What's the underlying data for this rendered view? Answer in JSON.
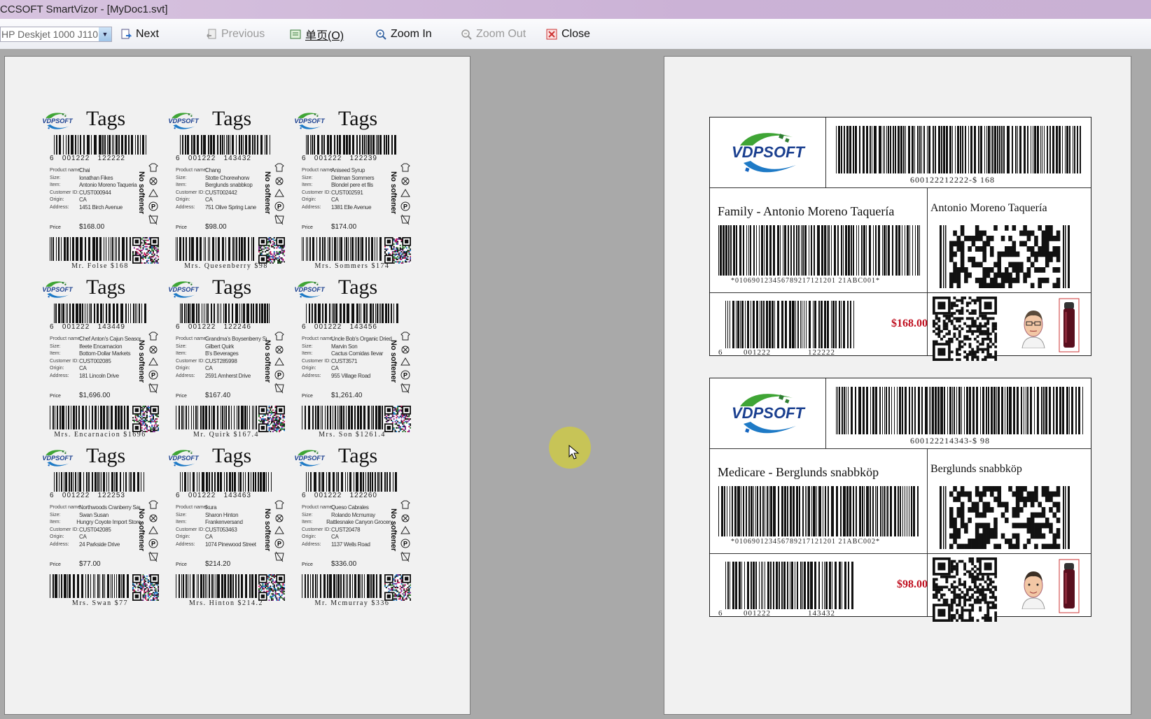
{
  "window": {
    "title": "CCSOFT SmartVizor - [MyDoc1.svt]"
  },
  "toolbar": {
    "printer": "HP Deskjet 1000 J110",
    "next": "Next",
    "previous": "Previous",
    "single_page": "单页(O)",
    "zoom_in": "Zoom In",
    "zoom_out": "Zoom Out",
    "close": "Close"
  },
  "colors": {
    "price_red": "#c01020",
    "logo_green": "#3fa535",
    "logo_blue": "#1e7ac6"
  },
  "small_labels": {
    "title": "Tags",
    "no_softener": "No softener",
    "logo_text": "VDPSOFT",
    "field_keys": [
      "Product name:",
      "Size:",
      "Item:",
      "Customer ID:",
      "Origin:",
      "Address:"
    ],
    "price_key": "Price",
    "items": [
      {
        "bcnum": "6   001222   122222",
        "values": [
          "Chai",
          "Ionathan Fikes",
          "Antonio Moreno Taqueria",
          "CUST000944",
          "CA",
          "1451 Birch Avenue"
        ],
        "price": "$168.00",
        "caption": "Mr. Folse $168"
      },
      {
        "bcnum": "6   001222   143432",
        "values": [
          "Chang",
          "Stotte Chorewhorw",
          "Berglunds snabbkop",
          "CUST002442",
          "CA",
          "751 Olive Spring Lane"
        ],
        "price": "$98.00",
        "caption": "Mrs. Quesenberry $98"
      },
      {
        "bcnum": "6   001222   122239",
        "values": [
          "Aniseed Syrup",
          "Dielman Sommers",
          "Blondel pere et fils",
          "CUST002591",
          "CA",
          "1381 Elle Avenue"
        ],
        "price": "$174.00",
        "caption": "Mrs. Sommers $174"
      },
      {
        "bcnum": "6   001222   143449",
        "values": [
          "Chef Anton's Cajun Seasoni",
          "Ifeete Encarnacion",
          "Bottom-Dollar Markets",
          "CUST002085",
          "CA",
          "181 Lincoln Drive"
        ],
        "price": "$1,696.00",
        "caption": "Mrs. Encarnacion $1696"
      },
      {
        "bcnum": "6   001222   122246",
        "values": [
          "Grandma's Boysenberry Spre",
          "Gilbert Quirk",
          "B's Beverages",
          "CUST285998",
          "CA",
          "2591 Amherst Drive"
        ],
        "price": "$167.40",
        "caption": "Mr. Quirk $167.4"
      },
      {
        "bcnum": "6   001222   143456",
        "values": [
          "Uncle Bob's Organic Dried P",
          "Marvin Son",
          "Cactus Comidas Ilevar",
          "CUST3571",
          "CA",
          "955 Village Road"
        ],
        "price": "$1,261.40",
        "caption": "Mrs. Son $1261.4"
      },
      {
        "bcnum": "6   001222   122253",
        "values": [
          "Northwoods Cranberry Sauce",
          "Swan Susan",
          "Hungry Coyote Import Store",
          "CUST042085",
          "CA",
          "24 Parkside Drive"
        ],
        "price": "$77.00",
        "caption": "Mrs. Swan $77"
      },
      {
        "bcnum": "6   001222   143463",
        "values": [
          "Ikura",
          "Sharon Hinton",
          "Frankenversand",
          "CUST053463",
          "CA",
          "1074 Pinewood Street"
        ],
        "price": "$214.20",
        "caption": "Mrs. Hinton $214.2"
      },
      {
        "bcnum": "6   001222   122260",
        "values": [
          "Queso Cabrales",
          "Rolando Mcmurray",
          "Rattlesnake Canyon Grocery",
          "CUST20478",
          "CA",
          "1137 Wells Road"
        ],
        "price": "$336.00",
        "caption": "Mr. Mcmurray $336"
      }
    ]
  },
  "big_labels": [
    {
      "logo_text": "VDPSOFT",
      "top_barcode_text": "600122212222-$ 168",
      "family": "Family - Antonio Moreno Taquería",
      "customer": "Antonio Moreno Taquería",
      "code128_text": "*010690123456789217121201 21ABC001*",
      "ean_left": "6",
      "ean_mid": "001222",
      "ean_right": "122222",
      "price": "$168.00",
      "person": "man-with-glasses"
    },
    {
      "logo_text": "VDPSOFT",
      "top_barcode_text": "600122214343-$ 98",
      "family": "Medicare - Berglunds snabbköp",
      "customer": "Berglunds snabbköp",
      "code128_text": "*010690123456789217121201 21ABC002*",
      "ean_left": "6",
      "ean_mid": "001222",
      "ean_right": "143432",
      "price": "$98.00",
      "person": "smiling-man"
    }
  ]
}
